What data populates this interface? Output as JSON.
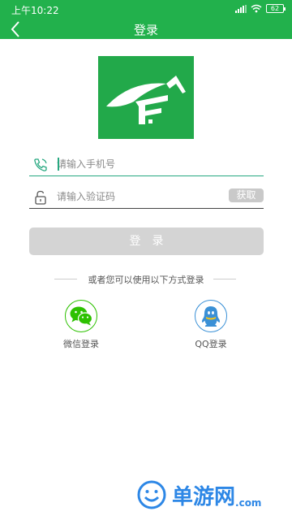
{
  "status_bar": {
    "time": "上午10:22",
    "battery": "62"
  },
  "nav": {
    "title": "登录"
  },
  "form": {
    "phone_placeholder": "请输入手机号",
    "code_placeholder": "请输入验证码",
    "get_code_label": "获取",
    "login_label": "登录"
  },
  "divider_text": "或者您可以使用以下方式登录",
  "social": {
    "wechat_label": "微信登录",
    "qq_label": "QQ登录"
  },
  "watermark": {
    "text": "单游网",
    "domain": ".com"
  },
  "colors": {
    "brand": "#22b14c",
    "field_line": "#27a880",
    "disabled": "#d4d4d4",
    "wechat": "#2dc100",
    "qq": "#3a90d6",
    "watermark": "#2d87e6"
  }
}
